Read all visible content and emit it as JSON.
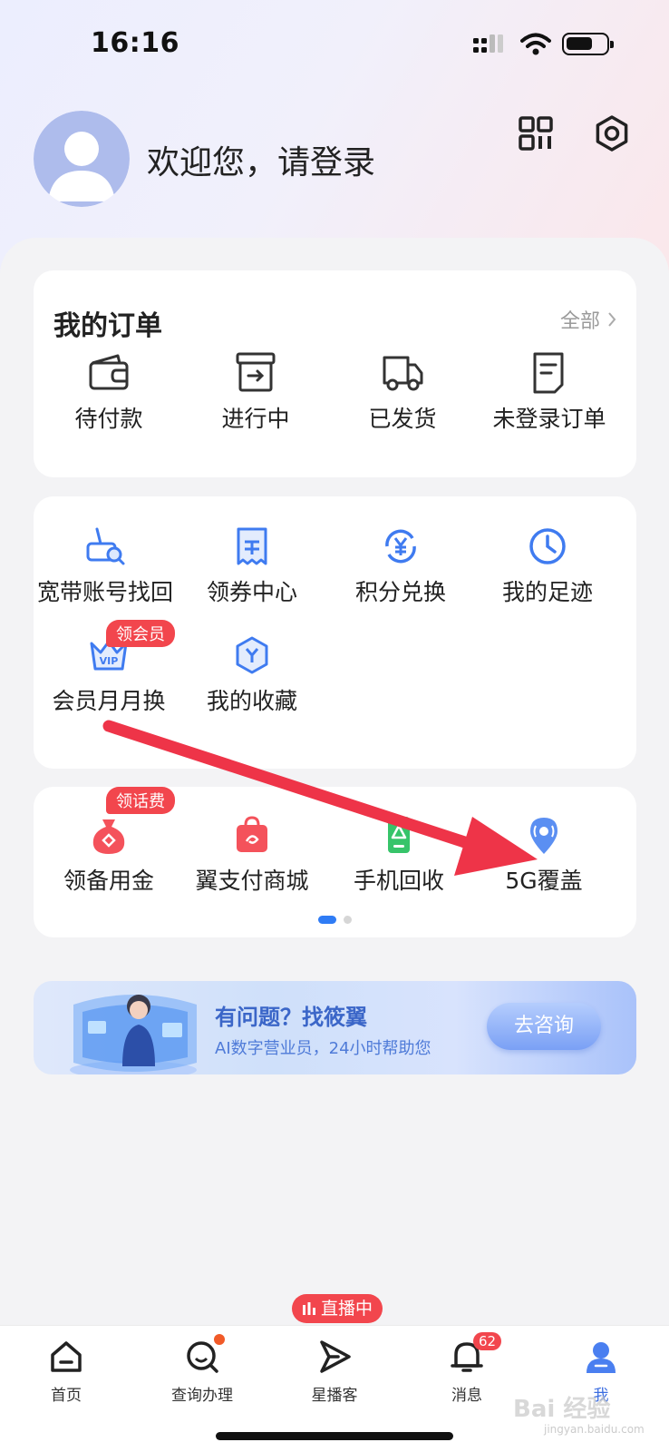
{
  "status_bar": {
    "time": "16:16"
  },
  "header": {
    "welcome": "欢迎您，请登录"
  },
  "orders": {
    "title": "我的订单",
    "see_all": "全部",
    "items": [
      {
        "label": "待付款",
        "icon": "wallet-icon"
      },
      {
        "label": "进行中",
        "icon": "box-arrow-icon"
      },
      {
        "label": "已发货",
        "icon": "truck-icon"
      },
      {
        "label": "未登录订单",
        "icon": "receipt-icon"
      }
    ]
  },
  "tools": {
    "items": [
      {
        "label": "宽带账号找回",
        "icon": "router-search-icon"
      },
      {
        "label": "领券中心",
        "icon": "coupon-icon"
      },
      {
        "label": "积分兑换",
        "icon": "yen-exchange-icon"
      },
      {
        "label": "我的足迹",
        "icon": "clock-icon"
      },
      {
        "label": "会员月月换",
        "icon": "vip-crown-icon",
        "badge": "领会员"
      },
      {
        "label": "我的收藏",
        "icon": "favorite-hex-icon"
      }
    ]
  },
  "more": {
    "items": [
      {
        "label": "领备用金",
        "icon": "money-bag-icon",
        "badge": "领话费"
      },
      {
        "label": "翼支付商城",
        "icon": "shopping-bag-icon"
      },
      {
        "label": "手机回收",
        "icon": "phone-recycle-icon"
      },
      {
        "label": "5G覆盖",
        "icon": "5g-location-icon"
      }
    ],
    "page_count": 2,
    "active_page": 1
  },
  "banner": {
    "title": "有问题？找筱翼",
    "subtitle": "AI数字营业员，24小时帮助您",
    "button": "去咨询"
  },
  "tabbar": {
    "live_badge": "直播中",
    "message_count": "62",
    "items": [
      {
        "label": "首页",
        "icon": "home-icon"
      },
      {
        "label": "查询办理",
        "icon": "search-service-icon"
      },
      {
        "label": "星播客",
        "icon": "play-send-icon"
      },
      {
        "label": "消息",
        "icon": "bell-icon"
      },
      {
        "label": "我",
        "icon": "user-icon",
        "active": true
      }
    ]
  },
  "colors": {
    "accent": "#3b6de0",
    "badge_red": "#f2464d",
    "arrow_red": "#ee3448"
  },
  "watermark": {
    "text": "Bai 经验",
    "sub": "jingyan.baidu.com"
  }
}
